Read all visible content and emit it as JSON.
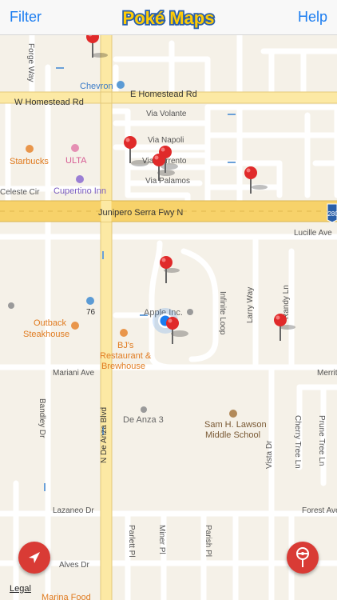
{
  "nav": {
    "left_label": "Filter",
    "right_label": "Help",
    "logo_text": "Poké Maps"
  },
  "map": {
    "streets": {
      "w_homestead": "W Homestead Rd",
      "e_homestead": "E Homestead Rd",
      "via_volante": "Via Volante",
      "via_napoli": "Via Napoli",
      "via_sorrento": "Via Sorrento",
      "via_palamos": "Via Palamos",
      "freeway": "Junipero Serra Fwy N",
      "freeway_shield": "280",
      "lucille": "Lucille Ave",
      "infinite_loop": "Infinite Loop",
      "larry_way": "Larry Way",
      "randy_ln": "Randy Ln",
      "mariani": "Mariani Ave",
      "merritt": "Merritt Dr",
      "bandley": "Bandley Dr",
      "de_anza_blvd": "N De Anza Blvd",
      "vista_dr": "Vista Dr",
      "cherry_tree": "Cherry Tree Ln",
      "prune_tree": "Prune Tree Ln",
      "lazaneo": "Lazaneo Dr",
      "forest": "Forest Ave",
      "parlett": "Parlett Pl",
      "miner": "Miner Pl",
      "parish": "Parish Pl",
      "alves": "Alves Dr",
      "forge": "Forge Way",
      "celeste": "Celeste Cir",
      "route76": "76"
    },
    "pois": {
      "chevron": "Chevron",
      "starbucks": "Starbucks",
      "ulta": "ULTA",
      "cupertino_inn": "Cupertino Inn",
      "apple_inc": "Apple Inc.",
      "outback_line1": "Outback",
      "outback_line2": "Steakhouse",
      "bjs_line1": "BJ's",
      "bjs_line2": "Restaurant &",
      "bjs_line3": "Brewhouse",
      "de_anza_3": "De Anza 3",
      "lawson_line1": "Sam H. Lawson",
      "lawson_line2": "Middle School",
      "marina_food": "Marina Food"
    }
  },
  "controls": {
    "legal": "Legal"
  },
  "colors": {
    "accent": "#1a7cf0",
    "pin": "#e02a2a",
    "fab": "#d93b35",
    "road_major": "#fce9a4",
    "road_minor": "#ffffff",
    "land": "#f5f1e8"
  }
}
